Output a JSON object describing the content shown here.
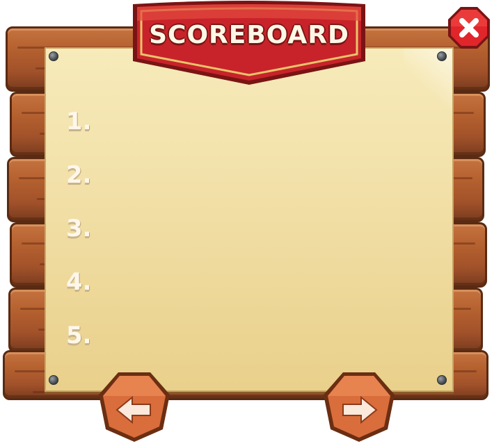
{
  "header": {
    "title": "SCOREBOARD"
  },
  "scoreboard": {
    "ranks": [
      {
        "label": "1."
      },
      {
        "label": "2."
      },
      {
        "label": "3."
      },
      {
        "label": "4."
      },
      {
        "label": "5."
      }
    ]
  },
  "icons": {
    "close": "close-icon",
    "prev": "arrow-left-icon",
    "next": "arrow-right-icon"
  },
  "colors": {
    "ribbon": "#c8232a",
    "close_button": "#e0262b",
    "wood": "#b4602f",
    "paper": "#f1dfa6"
  }
}
